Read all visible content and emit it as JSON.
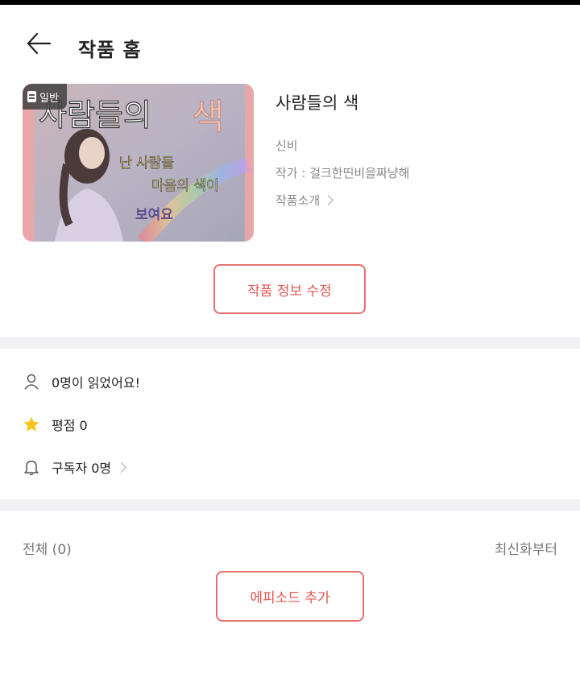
{
  "header": {
    "back_icon": "arrow-left-icon",
    "title": "작품 홈"
  },
  "work": {
    "badge_label": "일반",
    "badge_icon": "document-icon",
    "cover_text": {
      "title_part1": "사람들의",
      "title_part2": "색",
      "line1": "난 사람들",
      "line2": "마음의 색이",
      "line3": "보여요"
    },
    "title": "사람들의 색",
    "genre": "신비",
    "author": "작가 : 걸크한띤비을짜냥해",
    "intro_label": "작품소개"
  },
  "edit_button_label": "작품 정보 수정",
  "stats": {
    "readers": "0명이 읽었어요!",
    "rating": "평점 0",
    "subscribers": "구독자 0명"
  },
  "episodes": {
    "count_label": "전체 (0)",
    "sort_label": "최신화부터",
    "add_button_label": "에피소드 추가"
  },
  "colors": {
    "accent": "#e5564f",
    "accent_border": "#e8706f",
    "star": "#f5c518",
    "divider": "#f2f2f4"
  }
}
